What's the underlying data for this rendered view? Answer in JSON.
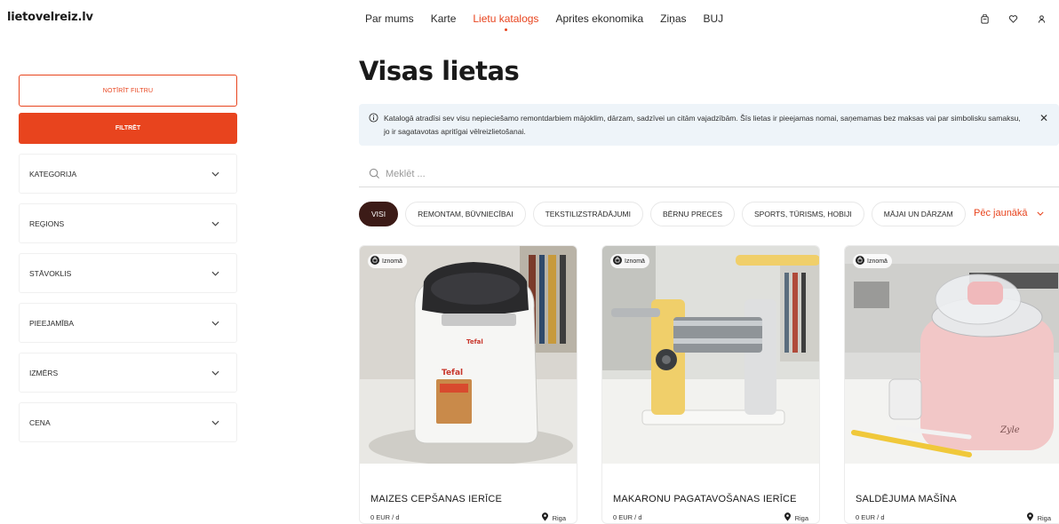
{
  "header": {
    "logo": "lietovelreiz.lv",
    "nav": [
      {
        "label": "Par mums",
        "active": false
      },
      {
        "label": "Karte",
        "active": false
      },
      {
        "label": "Lietu katalogs",
        "active": true
      },
      {
        "label": "Aprites ekonomika",
        "active": false
      },
      {
        "label": "Ziņas",
        "active": false
      },
      {
        "label": "BUJ",
        "active": false
      }
    ],
    "icons": [
      "cart-icon",
      "heart-icon",
      "user-icon"
    ]
  },
  "sidebar": {
    "clear_label": "NOTĪRĪT FILTRU",
    "filter_label": "FILTRĒT",
    "accordions": [
      "KATEGORIJA",
      "REĢIONS",
      "STĀVOKLIS",
      "PIEEJAMĪBA",
      "IZMĒRS",
      "CENA"
    ]
  },
  "main": {
    "title": "Visas lietas",
    "info": "Katalogā atradīsi sev visu nepieciešamo remontdarbiem mājoklim, dārzam, sadzīvei un citām vajadzībām. Šīs lietas ir pieejamas nomai, saņemamas bez maksas vai par simbolisku samaksu, jo ir sagatavotas apritīgai vēlreizlietošanai.",
    "search_placeholder": "Meklēt ...",
    "chips": [
      {
        "label": "VISI",
        "active": true
      },
      {
        "label": "REMONTAM, BŪVNIECĪBAI",
        "active": false
      },
      {
        "label": "TEKSTILIZSTRĀDĀJUMI",
        "active": false
      },
      {
        "label": "BĒRNU PRECES",
        "active": false
      },
      {
        "label": "SPORTS, TŪRISMS, HOBIJI",
        "active": false
      },
      {
        "label": "MĀJAI UN DĀRZAM",
        "active": false
      }
    ],
    "sort_label": "Pēc jaunākā",
    "cards": [
      {
        "badge": "Iznomā",
        "title": "MAIZES CEPŠANAS IERĪCE",
        "price": "0 EUR / d",
        "location": "Riga"
      },
      {
        "badge": "Iznomā",
        "title": "MAKARONU PAGATAVOŠANAS IERĪCE",
        "price": "0 EUR / d",
        "location": "Riga"
      },
      {
        "badge": "Iznomā",
        "title": "SALDĒJUMA MAŠĪNA",
        "price": "0 EUR / d",
        "location": "Riga"
      }
    ]
  },
  "colors": {
    "accent": "#e8441e",
    "chip_active": "#3c1b17",
    "info_bg": "#eef4f9"
  }
}
